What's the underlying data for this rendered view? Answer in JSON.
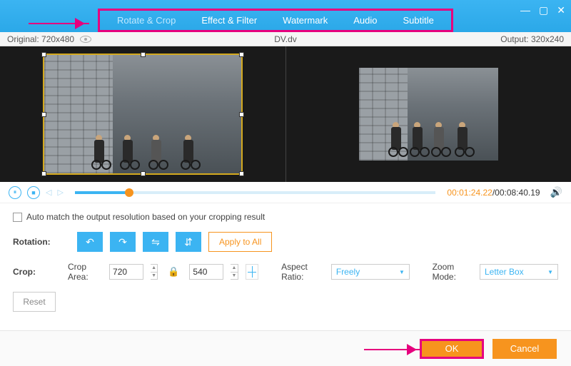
{
  "tabs": [
    "Rotate & Crop",
    "Effect & Filter",
    "Watermark",
    "Audio",
    "Subtitle"
  ],
  "info": {
    "original": "Original: 720x480",
    "filename": "DV.dv",
    "output": "Output: 320x240"
  },
  "playback": {
    "current": "00:01:24.22",
    "total": "/00:08:40.19"
  },
  "checkbox_label": "Auto match the output resolution based on your cropping result",
  "rotation_label": "Rotation:",
  "apply_all": "Apply to All",
  "crop_label": "Crop:",
  "crop_area_label": "Crop Area:",
  "crop_w": "720",
  "crop_h": "540",
  "aspect_label": "Aspect Ratio:",
  "aspect_value": "Freely",
  "zoom_label": "Zoom Mode:",
  "zoom_value": "Letter Box",
  "reset": "Reset",
  "ok": "OK",
  "cancel": "Cancel"
}
